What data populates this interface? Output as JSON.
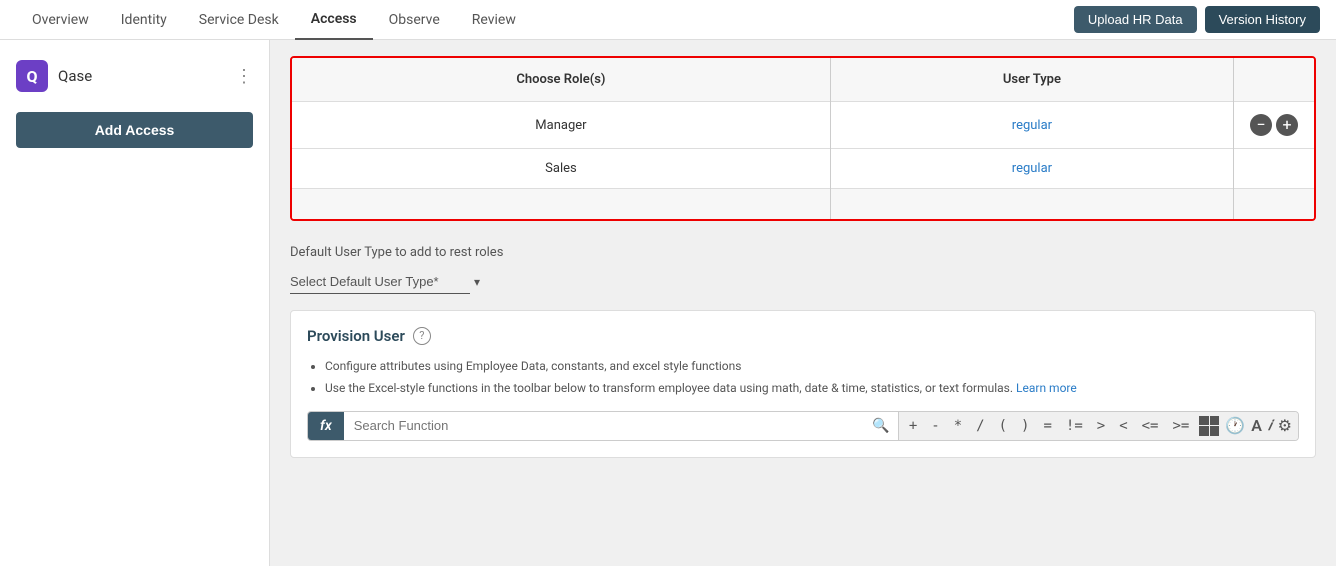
{
  "nav": {
    "items": [
      {
        "label": "Overview",
        "active": false
      },
      {
        "label": "Identity",
        "active": false
      },
      {
        "label": "Service Desk",
        "active": false
      },
      {
        "label": "Access",
        "active": true
      },
      {
        "label": "Observe",
        "active": false
      },
      {
        "label": "Review",
        "active": false
      }
    ],
    "upload_hr_label": "Upload HR Data",
    "version_history_label": "Version History"
  },
  "sidebar": {
    "brand_icon_letter": "Q",
    "brand_name": "Qase",
    "add_access_label": "Add Access"
  },
  "role_table": {
    "col_role": "Choose Role(s)",
    "col_user_type": "User Type",
    "rows": [
      {
        "role": "Manager",
        "user_type": "regular"
      },
      {
        "role": "Sales",
        "user_type": "regular"
      }
    ]
  },
  "default_user": {
    "label": "Default User Type to add to rest roles",
    "select_placeholder": "Select Default User Type*"
  },
  "provision": {
    "title": "Provision User",
    "help_tooltip": "?",
    "bullet1": "Configure attributes using Employee Data, constants, and excel style functions",
    "bullet2": "Use the Excel-style functions in the toolbar below to transform employee data using math, date & time, statistics, or text formulas.",
    "learn_more": "Learn more",
    "formula_fx": "fx",
    "search_placeholder": "Search Function",
    "toolbar_btns": [
      "+",
      "-",
      "*",
      "/",
      "(",
      ")",
      "=",
      "!=",
      ">",
      "<",
      "<=",
      ">="
    ]
  }
}
